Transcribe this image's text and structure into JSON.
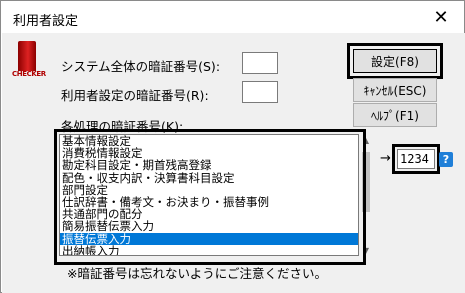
{
  "window": {
    "title": "利用者設定",
    "close_glyph": "✕"
  },
  "logo": {
    "text": "CHECKER",
    "icon": "app-logo-icon"
  },
  "fields": {
    "system_password_label": "システム全体の暗証番号(S):",
    "system_password_value": "",
    "user_password_label": "利用者設定の暗証番号(R):",
    "user_password_value": "",
    "process_password_label": "各処理の暗証番号(K):"
  },
  "buttons": {
    "settings": "設定(F8)",
    "cancel": "ｷｬﾝｾﾙ(ESC)",
    "help": "ﾍﾙﾌﾟ(F1)"
  },
  "process_list": {
    "items": [
      "基本情報設定",
      "消費税情報設定",
      "勘定科目設定・期首残高登録",
      "配色・収支内訳・決算書科目設定",
      "部門設定",
      "仕訳辞書・備考文・お決まり・振替事例",
      "共通部門の配分",
      "簡易振替伝票入力",
      "振替伝票入力",
      "出納帳入力"
    ],
    "selected_index": 8
  },
  "scrollbar": {
    "up_icon": "scroll-up-arrow-icon",
    "down_icon": "scroll-down-arrow-icon"
  },
  "selected_value": {
    "arrow": "→",
    "value": "1234",
    "help_icon": "?"
  },
  "note": "※暗証番号は忘れないようにご注意ください。",
  "colors": {
    "selection": "#0078d7",
    "help_icon": "#1f7fd8",
    "logo": "#b00000",
    "dialog_bg": "#f0f0f0"
  }
}
